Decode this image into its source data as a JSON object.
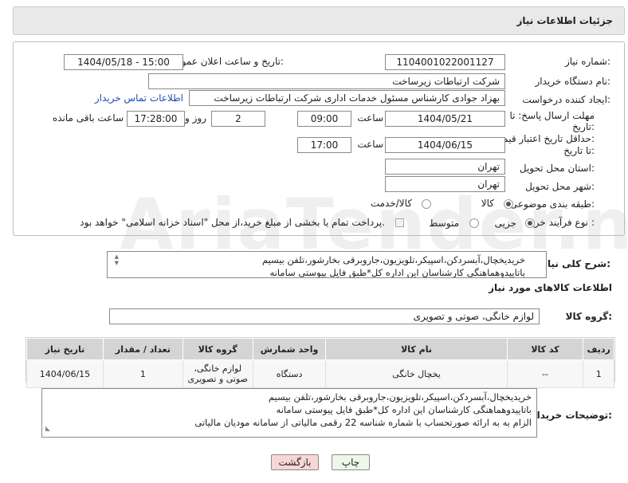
{
  "header": {
    "title": "جزئیات اطلاعات نیاز"
  },
  "form": {
    "need_number_label": "شماره نیاز:",
    "need_number": "1104001022001127",
    "announce_label": "تاریخ و ساعت اعلان عمومی:",
    "announce_value": "1404/05/18 - 15:00",
    "buyer_org_label": "نام دستگاه خریدار:",
    "buyer_org": "شرکت ارتباطات زیرساخت",
    "creator_label": "ایجاد کننده درخواست:",
    "creator": "بهزاد جوادی کارشناس مسئول خدمات اداری شرکت ارتباطات زیرساخت",
    "contact_link": "اطلاعات تماس خریدار",
    "deadline_label_1": "مهلت ارسال پاسخ: تا",
    "deadline_label_2": "تاریخ:",
    "deadline_date": "1404/05/21",
    "time_label": "ساعت",
    "deadline_time": "09:00",
    "days_value": "2",
    "days_label": "روز و",
    "remaining_time": "17:28:00",
    "remaining_label": "ساعت باقی مانده",
    "validity_label_1": "حداقل تاریخ اعتبار قیمت:",
    "validity_label_2": "تا تاریخ:",
    "validity_date": "1404/06/15",
    "validity_time_label": "ساعت",
    "validity_time": "17:00",
    "province_label": "استان محل تحویل:",
    "province": "تهران",
    "city_label": "شهر محل تحویل:",
    "city": "تهران",
    "category_label": "طبقه بندی موضوعی:",
    "category_options": [
      "کالا",
      "کالا/خدمت"
    ],
    "category_selected": "کالا",
    "process_label": "نوع فرآیند خرید :",
    "process_options": [
      "جزیی",
      "متوسط"
    ],
    "process_selected": "جزیی",
    "payment_note": "پرداخت تمام یا بخشی از مبلغ خرید،از محل \"اسناد خزانه اسلامی\" خواهد بود."
  },
  "description": {
    "label": "شرح کلی نیاز:",
    "line1": "خریدیخچال،آبسردکن،اسپیکر،تلویزیون،جاروبرقی بخارشور،تلفن بیسیم",
    "line2": "باتاییدوهماهنگی کارشناسان این اداره کل*طبق فایل پیوستی سامانه"
  },
  "goods": {
    "section_title": "اطلاعات کالاهای مورد نیاز",
    "group_label": "گروه کالا:",
    "group_value": "لوازم خانگی، صوتی و تصویری",
    "columns": [
      "ردیف",
      "کد کالا",
      "نام کالا",
      "واحد شمارش",
      "گروه کالا",
      "تعداد / مقدار",
      "تاریخ نیاز"
    ],
    "rows": [
      {
        "row": "1",
        "code": "--",
        "name": "یخچال خانگی",
        "unit": "دستگاه",
        "group_line1": "لوازم خانگی،",
        "group_line2": "صوتی و تصویری",
        "qty": "1",
        "date": "1404/06/15"
      }
    ]
  },
  "buyer_notes": {
    "label": "توضیحات خریدار:",
    "line1": "خریدیخچال،آبسردکن،اسپیکر،تلویزیون،جاروبرقی بخارشور،تلفن بیسیم",
    "line2": "باتاییدوهماهنگی کارشناسان این اداره کل*طبق فایل پیوستی سامانه",
    "line3": "الزام به به ارائه صورتحساب با شماره شناسه 22 رقمی مالیاتی از سامانه مودیان مالیاتی"
  },
  "buttons": {
    "print": "چاپ",
    "back": "بازگشت"
  },
  "watermark": "AriaTender.net",
  "colors": {
    "back_button_bg": "#f9d6d6",
    "print_button_bg": "#eef7e8",
    "link": "#1a4fb3"
  }
}
